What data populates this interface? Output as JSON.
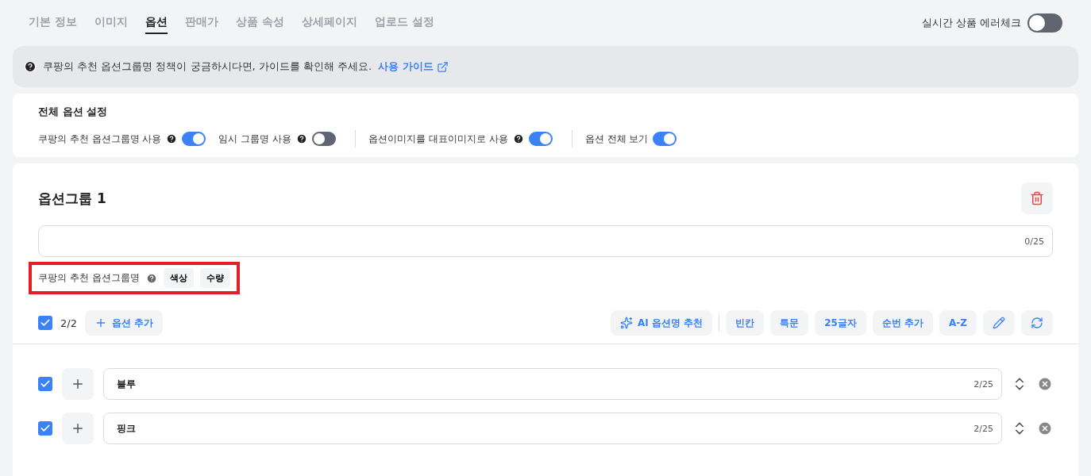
{
  "tabs": [
    {
      "label": "기본 정보",
      "selected": false
    },
    {
      "label": "이미지",
      "selected": false
    },
    {
      "label": "옵션",
      "selected": true
    },
    {
      "label": "판매가",
      "selected": false
    },
    {
      "label": "상품 속성",
      "selected": false
    },
    {
      "label": "상세페이지",
      "selected": false
    },
    {
      "label": "업로드 설정",
      "selected": false
    }
  ],
  "error_check": {
    "label": "실시간 상품 에러체크",
    "on": false
  },
  "notice": {
    "text": "쿠팡의 추천 옵션그룹명 정책이 궁금하시다면, 가이드를 확인해 주세요.",
    "link": "사용 가이드"
  },
  "settings": {
    "title": "전체 옵션 설정",
    "toggles": [
      {
        "label": "쿠팡의 추천 옵션그룹명 사용",
        "help": true,
        "on": true
      },
      {
        "label": "임시 그룹명 사용",
        "help": true,
        "on": false
      },
      {
        "label": "옵션이미지를 대표이미지로 사용",
        "help": true,
        "on": true
      },
      {
        "label": "옵션 전체 보기",
        "help": false,
        "on": true
      }
    ]
  },
  "group": {
    "title": "옵션그룹 1",
    "name_counter": "0/25",
    "recommend_label": "쿠팡의 추천 옵션그룹명",
    "recommendations": [
      "색상",
      "수량"
    ],
    "all_checked": true,
    "count": "2/2",
    "add_label": "옵션 추가",
    "tools": [
      {
        "kind": "ai",
        "label": "AI 옵션명 추천"
      },
      {
        "kind": "text",
        "label": "빈칸"
      },
      {
        "kind": "text",
        "label": "특문"
      },
      {
        "kind": "text",
        "label": "25글자"
      },
      {
        "kind": "text",
        "label": "순번 추가"
      },
      {
        "kind": "text",
        "label": "A-Z"
      },
      {
        "kind": "edit"
      },
      {
        "kind": "refresh"
      }
    ],
    "options": [
      {
        "checked": true,
        "value": "블루",
        "counter": "2/25"
      },
      {
        "checked": true,
        "value": "핑크",
        "counter": "2/25"
      }
    ]
  }
}
